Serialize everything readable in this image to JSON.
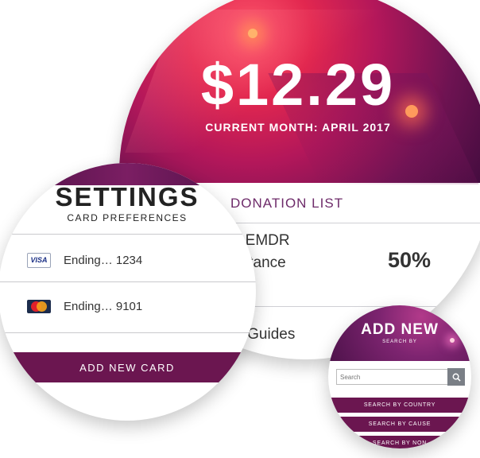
{
  "donation": {
    "amount": "$12.29",
    "month_label": "CURRENT MONTH: APRIL 2017",
    "list_title": "DONATION LIST",
    "item1_line1": "y, EMDR",
    "item1_line2": "sistance",
    "item1_percent": "50%",
    "item2": "th Guides"
  },
  "settings": {
    "title": "SETTINGS",
    "subtitle": "CARD PREFERENCES",
    "cards": [
      {
        "brand": "VISA",
        "icon": "visa-card-icon",
        "text": "Ending… 1234"
      },
      {
        "brand": "MasterCard",
        "icon": "mastercard-icon",
        "text": "Ending… 9101"
      }
    ],
    "add_button": "ADD NEW CARD"
  },
  "add_new": {
    "title": "ADD NEW",
    "subtitle": "SEARCH BY",
    "search_placeholder": "Search",
    "buttons": [
      "SEARCH BY COUNTRY",
      "SEARCH BY CAUSE",
      "SEARCH BY NON"
    ]
  },
  "colors": {
    "accent": "#6b1650",
    "hero_red": "#e2274f",
    "hero_purple": "#6e1352"
  }
}
